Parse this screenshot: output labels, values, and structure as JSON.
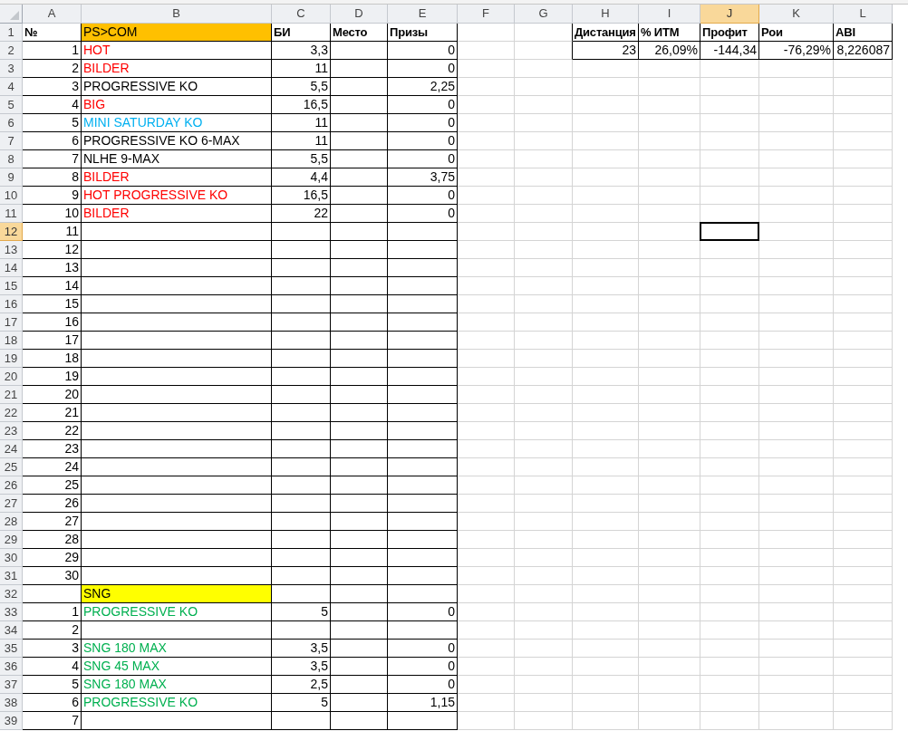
{
  "columns": [
    {
      "label": "A",
      "selected": false
    },
    {
      "label": "B",
      "selected": false
    },
    {
      "label": "C",
      "selected": false
    },
    {
      "label": "D",
      "selected": false
    },
    {
      "label": "E",
      "selected": false
    },
    {
      "label": "F",
      "selected": false
    },
    {
      "label": "G",
      "selected": false
    },
    {
      "label": "H",
      "selected": false
    },
    {
      "label": "I",
      "selected": false
    },
    {
      "label": "J",
      "selected": true
    },
    {
      "label": "K",
      "selected": false
    },
    {
      "label": "L",
      "selected": false
    }
  ],
  "rows": [
    {
      "header": "1",
      "selected": false,
      "cells": {
        "A": {
          "text": "№",
          "kind": "label",
          "bold": true
        },
        "B": {
          "text": "PS>COM",
          "kind": "filled",
          "color": "#ffc000"
        },
        "C": {
          "text": "БИ",
          "kind": "label",
          "bold": true
        },
        "D": {
          "text": "Место",
          "kind": "label",
          "bold": true
        },
        "E": {
          "text": "Призы",
          "kind": "label",
          "bold": true
        },
        "H": {
          "text": "Дистанция",
          "kind": "label",
          "bold": true
        },
        "I": {
          "text": "% ИТМ",
          "kind": "label",
          "bold": true
        },
        "J": {
          "text": "Профит",
          "kind": "label",
          "bold": true
        },
        "K": {
          "text": "Рои",
          "kind": "label",
          "bold": true
        },
        "L": {
          "text": "ABI",
          "kind": "label",
          "bold": true
        }
      }
    },
    {
      "header": "2",
      "selected": false,
      "cells": {
        "A": {
          "text": "1",
          "kind": "number"
        },
        "B": {
          "text": "HOT",
          "kind": "colored",
          "color": "#ff0000"
        },
        "C": {
          "text": "3,3",
          "kind": "number"
        },
        "E": {
          "text": "0",
          "kind": "number"
        },
        "H": {
          "text": "23",
          "kind": "number"
        },
        "I": {
          "text": "26,09%",
          "kind": "number"
        },
        "J": {
          "text": "-144,34",
          "kind": "number"
        },
        "K": {
          "text": "-76,29%",
          "kind": "number"
        },
        "L": {
          "text": "8,226087",
          "kind": "number"
        }
      }
    },
    {
      "header": "3",
      "selected": false,
      "cells": {
        "A": {
          "text": "2",
          "kind": "number"
        },
        "B": {
          "text": "BILDER",
          "kind": "colored",
          "color": "#ff0000"
        },
        "C": {
          "text": "11",
          "kind": "number"
        },
        "E": {
          "text": "0",
          "kind": "number"
        }
      }
    },
    {
      "header": "4",
      "selected": false,
      "cells": {
        "A": {
          "text": "3",
          "kind": "number"
        },
        "B": {
          "text": "PROGRESSIVE KO",
          "kind": "label"
        },
        "C": {
          "text": "5,5",
          "kind": "number"
        },
        "E": {
          "text": "2,25",
          "kind": "number"
        }
      }
    },
    {
      "header": "5",
      "selected": false,
      "cells": {
        "A": {
          "text": "4",
          "kind": "number"
        },
        "B": {
          "text": "BIG",
          "kind": "colored",
          "color": "#ff0000"
        },
        "C": {
          "text": "16,5",
          "kind": "number"
        },
        "E": {
          "text": "0",
          "kind": "number"
        }
      }
    },
    {
      "header": "6",
      "selected": false,
      "cells": {
        "A": {
          "text": "5",
          "kind": "number"
        },
        "B": {
          "text": "MINI SATURDAY KO",
          "kind": "colored",
          "color": "#00b0f0"
        },
        "C": {
          "text": "11",
          "kind": "number"
        },
        "E": {
          "text": "0",
          "kind": "number"
        }
      }
    },
    {
      "header": "7",
      "selected": false,
      "cells": {
        "A": {
          "text": "6",
          "kind": "number"
        },
        "B": {
          "text": "PROGRESSIVE KO 6-MAX",
          "kind": "label"
        },
        "C": {
          "text": "11",
          "kind": "number"
        },
        "E": {
          "text": "0",
          "kind": "number"
        }
      }
    },
    {
      "header": "8",
      "selected": false,
      "cells": {
        "A": {
          "text": "7",
          "kind": "number"
        },
        "B": {
          "text": "NLHE 9-MAX",
          "kind": "label"
        },
        "C": {
          "text": "5,5",
          "kind": "number"
        },
        "E": {
          "text": "0",
          "kind": "number"
        }
      }
    },
    {
      "header": "9",
      "selected": false,
      "cells": {
        "A": {
          "text": "8",
          "kind": "number"
        },
        "B": {
          "text": "BILDER",
          "kind": "colored",
          "color": "#ff0000"
        },
        "C": {
          "text": "4,4",
          "kind": "number"
        },
        "E": {
          "text": "3,75",
          "kind": "number"
        }
      }
    },
    {
      "header": "10",
      "selected": false,
      "cells": {
        "A": {
          "text": "9",
          "kind": "number"
        },
        "B": {
          "text": "HOT PROGRESSIVE KO",
          "kind": "colored",
          "color": "#ff0000"
        },
        "C": {
          "text": "16,5",
          "kind": "number"
        },
        "E": {
          "text": "0",
          "kind": "number"
        }
      }
    },
    {
      "header": "11",
      "selected": false,
      "cells": {
        "A": {
          "text": "10",
          "kind": "number"
        },
        "B": {
          "text": "BILDER",
          "kind": "colored",
          "color": "#ff0000"
        },
        "C": {
          "text": "22",
          "kind": "number"
        },
        "E": {
          "text": "0",
          "kind": "number"
        }
      }
    },
    {
      "header": "12",
      "selected": true,
      "cells": {
        "A": {
          "text": "11",
          "kind": "number"
        }
      }
    },
    {
      "header": "13",
      "selected": false,
      "cells": {
        "A": {
          "text": "12",
          "kind": "number"
        }
      }
    },
    {
      "header": "14",
      "selected": false,
      "cells": {
        "A": {
          "text": "13",
          "kind": "number"
        }
      }
    },
    {
      "header": "15",
      "selected": false,
      "cells": {
        "A": {
          "text": "14",
          "kind": "number"
        }
      }
    },
    {
      "header": "16",
      "selected": false,
      "cells": {
        "A": {
          "text": "15",
          "kind": "number"
        }
      }
    },
    {
      "header": "17",
      "selected": false,
      "cells": {
        "A": {
          "text": "16",
          "kind": "number"
        }
      }
    },
    {
      "header": "18",
      "selected": false,
      "cells": {
        "A": {
          "text": "17",
          "kind": "number"
        }
      }
    },
    {
      "header": "19",
      "selected": false,
      "cells": {
        "A": {
          "text": "18",
          "kind": "number"
        }
      }
    },
    {
      "header": "20",
      "selected": false,
      "cells": {
        "A": {
          "text": "19",
          "kind": "number"
        }
      }
    },
    {
      "header": "21",
      "selected": false,
      "cells": {
        "A": {
          "text": "20",
          "kind": "number"
        }
      }
    },
    {
      "header": "22",
      "selected": false,
      "cells": {
        "A": {
          "text": "21",
          "kind": "number"
        }
      }
    },
    {
      "header": "23",
      "selected": false,
      "cells": {
        "A": {
          "text": "22",
          "kind": "number"
        }
      }
    },
    {
      "header": "24",
      "selected": false,
      "cells": {
        "A": {
          "text": "23",
          "kind": "number"
        }
      }
    },
    {
      "header": "25",
      "selected": false,
      "cells": {
        "A": {
          "text": "24",
          "kind": "number"
        }
      }
    },
    {
      "header": "26",
      "selected": false,
      "cells": {
        "A": {
          "text": "25",
          "kind": "number"
        }
      }
    },
    {
      "header": "27",
      "selected": false,
      "cells": {
        "A": {
          "text": "26",
          "kind": "number"
        }
      }
    },
    {
      "header": "28",
      "selected": false,
      "cells": {
        "A": {
          "text": "27",
          "kind": "number"
        }
      }
    },
    {
      "header": "29",
      "selected": false,
      "cells": {
        "A": {
          "text": "28",
          "kind": "number"
        }
      }
    },
    {
      "header": "30",
      "selected": false,
      "cells": {
        "A": {
          "text": "29",
          "kind": "number"
        }
      }
    },
    {
      "header": "31",
      "selected": false,
      "cells": {
        "A": {
          "text": "30",
          "kind": "number"
        }
      }
    },
    {
      "header": "32",
      "selected": false,
      "cells": {
        "B": {
          "text": "SNG",
          "kind": "filled",
          "color": "#ffff00"
        }
      }
    },
    {
      "header": "33",
      "selected": false,
      "cells": {
        "A": {
          "text": "1",
          "kind": "number"
        },
        "B": {
          "text": "PROGRESSIVE KO",
          "kind": "colored",
          "color": "#00b050"
        },
        "C": {
          "text": "5",
          "kind": "number"
        },
        "E": {
          "text": "0",
          "kind": "number"
        }
      }
    },
    {
      "header": "34",
      "selected": false,
      "cells": {
        "A": {
          "text": "2",
          "kind": "number"
        }
      }
    },
    {
      "header": "35",
      "selected": false,
      "cells": {
        "A": {
          "text": "3",
          "kind": "number"
        },
        "B": {
          "text": "SNG 180 MAX",
          "kind": "colored",
          "color": "#00b050"
        },
        "C": {
          "text": "3,5",
          "kind": "number"
        },
        "E": {
          "text": "0",
          "kind": "number"
        }
      }
    },
    {
      "header": "36",
      "selected": false,
      "cells": {
        "A": {
          "text": "4",
          "kind": "number"
        },
        "B": {
          "text": "SNG 45 MAX",
          "kind": "colored",
          "color": "#00b050"
        },
        "C": {
          "text": "3,5",
          "kind": "number"
        },
        "E": {
          "text": "0",
          "kind": "number"
        }
      }
    },
    {
      "header": "37",
      "selected": false,
      "cells": {
        "A": {
          "text": "5",
          "kind": "number"
        },
        "B": {
          "text": "SNG 180 MAX",
          "kind": "colored",
          "color": "#00b050"
        },
        "C": {
          "text": "2,5",
          "kind": "number"
        },
        "E": {
          "text": "0",
          "kind": "number"
        }
      }
    },
    {
      "header": "38",
      "selected": false,
      "cells": {
        "A": {
          "text": "6",
          "kind": "number"
        },
        "B": {
          "text": "PROGRESSIVE KO",
          "kind": "colored",
          "color": "#00b050"
        },
        "C": {
          "text": "5",
          "kind": "number"
        },
        "E": {
          "text": "1,15",
          "kind": "number"
        }
      }
    },
    {
      "header": "39",
      "selected": false,
      "cells": {
        "A": {
          "text": "7",
          "kind": "number"
        }
      }
    }
  ]
}
